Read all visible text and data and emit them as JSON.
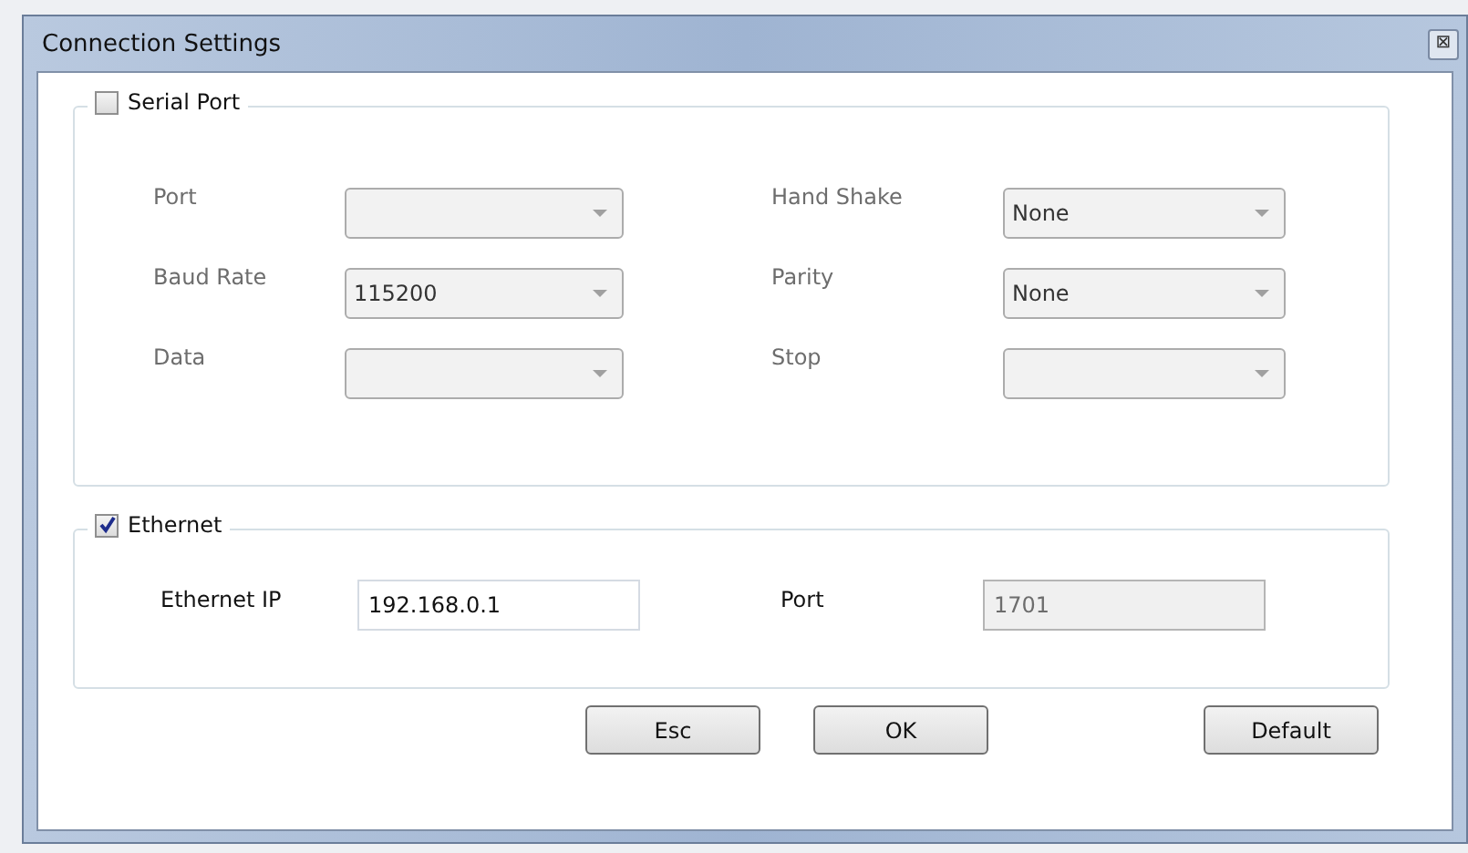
{
  "window": {
    "title": "Connection Settings",
    "close": "⊠"
  },
  "serial_port": {
    "label": "Serial Port",
    "checked": false,
    "fields": [
      {
        "label": "Port"
      },
      {
        "label": "Hand Shake",
        "value": "None"
      },
      {
        "label": "Baud Rate",
        "value": "115200"
      },
      {
        "label": "Parity",
        "value": "None"
      },
      {
        "label": "Data"
      },
      {
        "label": "Stop"
      }
    ]
  },
  "ethernet": {
    "label": "Ethernet",
    "checked": true,
    "fields": [
      {
        "label": "Ethernet IP",
        "value": "192.168.0.1",
        "disabled": false
      },
      {
        "label": "Port",
        "value": "1701",
        "disabled": true
      }
    ]
  },
  "buttons": [
    "Esc",
    "OK",
    "Default"
  ]
}
